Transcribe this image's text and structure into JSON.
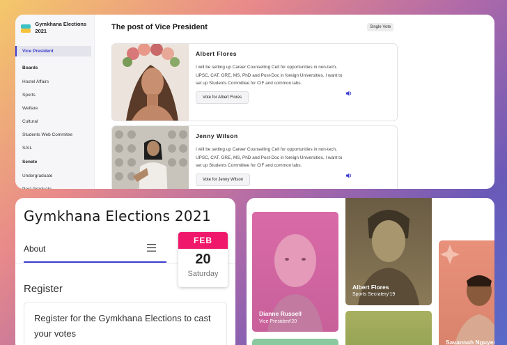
{
  "sidebar": {
    "brand": "Gymkhana Elections 2021",
    "active_item": "Vice President",
    "sections": [
      {
        "heading": "Boards",
        "items": [
          "Hostel Affairs",
          "Sports",
          "Welfare",
          "Cultural",
          "Students Web Commitee",
          "SAIL"
        ]
      },
      {
        "heading": "Senete",
        "items": [
          "Undergraduate",
          "Post Graduate"
        ]
      }
    ]
  },
  "main": {
    "title": "The post of Vice President",
    "badge": "Single Vote",
    "candidates": [
      {
        "name": "Albert Flores",
        "bio": "I will be setting up Career Counselling Cell for opportunities in non-tech, UPSC, CAT, GRE, MS, PhD and Post-Doc in foreign Universities. I want to set up Students Committee for CIF and common labs.",
        "vote_label": "Vote for Albert Flores"
      },
      {
        "name": "Jenny Wilson",
        "bio": "I will be setting up Career Counselling Cell for opportunities in non-tech, UPSC, CAT, GRE, MS, PhD and Post-Doc in foreign Universities. I want to set up Students Committee for CIF and common labs.",
        "vote_label": "Vote for Jenny Wilson"
      }
    ]
  },
  "mobile": {
    "title": "Gymkhana Elections 2021",
    "tab": "About",
    "date": {
      "month": "FEB",
      "day": "20",
      "weekday": "Saturday"
    },
    "register_heading": "Register",
    "register_text": "Register for the Gymkhana Elections to cast your votes"
  },
  "gallery": [
    {
      "name": "Dianne Russell",
      "role": "Vice President'20"
    },
    {
      "name": "Albert Flores",
      "role": "Sports Secratery'19"
    },
    {
      "name": "Savannah Nguyen",
      "role": ""
    }
  ],
  "colors": {
    "accent": "#3c3cd0",
    "date_header": "#f0186a"
  }
}
